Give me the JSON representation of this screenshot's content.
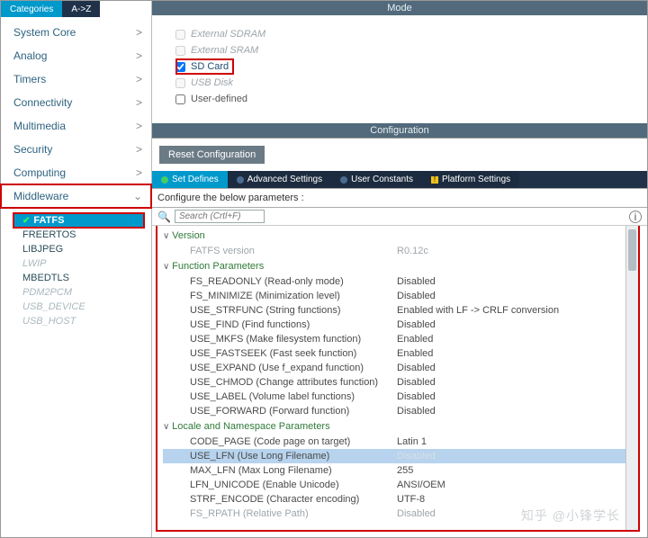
{
  "sidebar": {
    "tabs": {
      "categories": "Categories",
      "az": "A->Z"
    },
    "groups": [
      {
        "label": "System Core",
        "boxed": false
      },
      {
        "label": "Analog",
        "boxed": false
      },
      {
        "label": "Timers",
        "boxed": false
      },
      {
        "label": "Connectivity",
        "boxed": false
      },
      {
        "label": "Multimedia",
        "boxed": false
      },
      {
        "label": "Security",
        "boxed": false
      },
      {
        "label": "Computing",
        "boxed": false
      },
      {
        "label": "Middleware",
        "boxed": true,
        "open": true
      }
    ],
    "middleware_items": [
      {
        "label": "FATFS",
        "selected": true,
        "faded": false
      },
      {
        "label": "FREERTOS",
        "selected": false,
        "faded": false
      },
      {
        "label": "LIBJPEG",
        "selected": false,
        "faded": false
      },
      {
        "label": "LWIP",
        "selected": false,
        "faded": true
      },
      {
        "label": "MBEDTLS",
        "selected": false,
        "faded": false
      },
      {
        "label": "PDM2PCM",
        "selected": false,
        "faded": true
      },
      {
        "label": "USB_DEVICE",
        "selected": false,
        "faded": true
      },
      {
        "label": "USB_HOST",
        "selected": false,
        "faded": true
      }
    ]
  },
  "mode": {
    "title": "Mode",
    "options": [
      {
        "label": "External SDRAM",
        "checked": false,
        "faded": true,
        "boxed": false
      },
      {
        "label": "External SRAM",
        "checked": false,
        "faded": true,
        "boxed": false
      },
      {
        "label": "SD Card",
        "checked": true,
        "faded": false,
        "boxed": true
      },
      {
        "label": "USB Disk",
        "checked": false,
        "faded": true,
        "boxed": false
      },
      {
        "label": "User-defined",
        "checked": false,
        "faded": false,
        "boxed": false
      }
    ]
  },
  "config": {
    "title": "Configuration",
    "reset_label": "Reset Configuration",
    "tabs": [
      {
        "label": "Set Defines",
        "active": true,
        "dot": "ok"
      },
      {
        "label": "Advanced Settings",
        "active": false,
        "dot": "neutral"
      },
      {
        "label": "User Constants",
        "active": false,
        "dot": "neutral"
      },
      {
        "label": "Platform Settings",
        "active": false,
        "dot": "warn"
      }
    ],
    "desc": "Configure the below parameters :",
    "search_placeholder": "Search (Crtl+F)",
    "sections": [
      {
        "name": "Version",
        "rows": [
          {
            "pname": "FATFS version",
            "pval": "R0.12c",
            "faded": true
          }
        ]
      },
      {
        "name": "Function Parameters",
        "rows": [
          {
            "pname": "FS_READONLY (Read-only mode)",
            "pval": "Disabled"
          },
          {
            "pname": "FS_MINIMIZE (Minimization level)",
            "pval": "Disabled"
          },
          {
            "pname": "USE_STRFUNC (String functions)",
            "pval": "Enabled with LF -> CRLF conversion"
          },
          {
            "pname": "USE_FIND (Find functions)",
            "pval": "Disabled"
          },
          {
            "pname": "USE_MKFS (Make filesystem function)",
            "pval": "Enabled"
          },
          {
            "pname": "USE_FASTSEEK (Fast seek function)",
            "pval": "Enabled"
          },
          {
            "pname": "USE_EXPAND (Use f_expand function)",
            "pval": "Disabled"
          },
          {
            "pname": "USE_CHMOD (Change attributes function)",
            "pval": "Disabled"
          },
          {
            "pname": "USE_LABEL (Volume label functions)",
            "pval": "Disabled"
          },
          {
            "pname": "USE_FORWARD (Forward function)",
            "pval": "Disabled"
          }
        ]
      },
      {
        "name": "Locale and Namespace Parameters",
        "rows": [
          {
            "pname": "CODE_PAGE (Code page on target)",
            "pval": "Latin 1"
          },
          {
            "pname": "USE_LFN (Use Long Filename)",
            "pval": "Disabled",
            "selected": true
          },
          {
            "pname": "MAX_LFN (Max Long Filename)",
            "pval": "255"
          },
          {
            "pname": "LFN_UNICODE (Enable Unicode)",
            "pval": "ANSI/OEM"
          },
          {
            "pname": "STRF_ENCODE (Character encoding)",
            "pval": "UTF-8"
          },
          {
            "pname": "FS_RPATH (Relative Path)",
            "pval": "Disabled",
            "faded": true
          }
        ]
      }
    ]
  },
  "watermark": "知乎 @小锋学长"
}
